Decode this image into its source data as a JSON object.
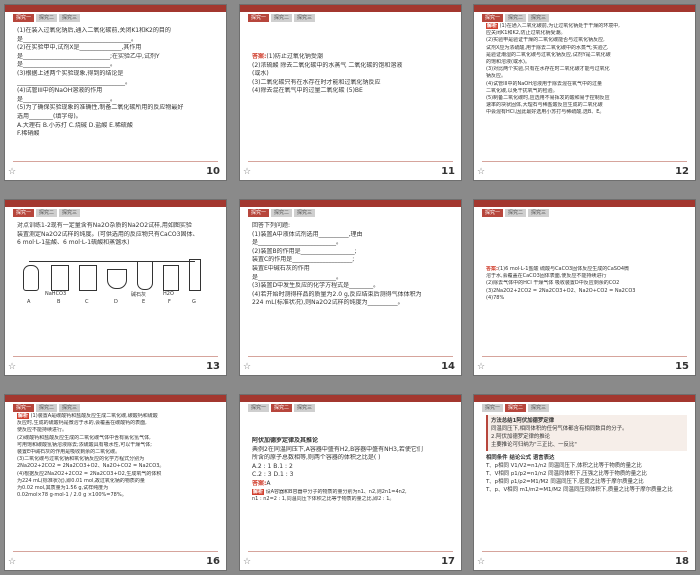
{
  "colors": {
    "accent": "#a3372f",
    "answer": "#d1402f",
    "background": "#8a8a8a"
  },
  "tabs": {
    "first": "探究一",
    "second": "探究二",
    "third": "探究三"
  },
  "slides": [
    {
      "number": "10",
      "lines": [
        "(1)在装入过氧化钠后,通入二氧化碳前,关闭K1和K2的目的",
        "是____________________________________。",
        "(2)在实验甲中,试剂X是______________,其作用",
        "是_____________________________;在实验乙中,试剂Y",
        "是_____________________________。",
        "(3)根据上述两个实验现象,得到的结论是",
        "____________________________________。",
        "(4)试管III中的NaOH溶液的作用",
        "是_____________________________。",
        "(5)为了确保实验现象的准确性,制备二氧化碳所用的反应物最好",
        "选用________(填字母)。",
        "A.大理石   B.小苏打   C.烧碱   D.盐酸   E.稀硫酸",
        "F.稀硝酸"
      ]
    },
    {
      "number": "11",
      "answer_label": "答案:",
      "lines": [
        "(1)防止过氧化钠受潮",
        "(2)浓硫酸  除去二氧化碳中的水蒸气  二氧化碳的饱和溶液",
        "(或水)",
        "(3)二氧化碳只有在水存在时才能和过氧化钠反应",
        "(4)除去混在氧气中的过量二氧化碳  (5)BE"
      ]
    },
    {
      "number": "12",
      "hint_label": "解析",
      "lines": [
        "(1)在通入二氧化碳前,为让过氧化钠处于干燥的环境中,",
        "应关闭K1和K2,防止过氧化钠受潮。",
        "(2)实验甲是验证干燥的二氧化碳能否与过氧化钠反应,",
        "试剂X应为浓硫酸,用于除去二氧化碳中的水蒸气;实验乙",
        "是验证潮湿的二氧化碳与过氧化钠反应,试剂Y是二氧化碳",
        "的饱和溶液(或水)。",
        "(3)对比两个实验,只有在水存在时二氧化碳才能与过氧化",
        "钠反应。",
        "(4)试管III中的NaOH溶液用于除去混在氧气中的过量",
        "二氧化碳,以免干扰氧气的检验。",
        "(5)制备二氧化碳时,应选用不易挥发的酸和易于控制反应",
        "速率的块状固体,大理石与稀盐酸反应生成的二氧化碳",
        "中会混有HCl,因此最好选用小苏打与稀硫酸,选B、E。"
      ]
    },
    {
      "number": "13",
      "lines": [
        "对点训练1-2现有一定量含有Na2O杂质的Na2O2试样,用如图实验",
        "装置测定Na2O2试样的纯度。(可供选用的反应物只有CaCO3固体、",
        "6 mol·L-1盐酸、6 mol·L-1硫酸和蒸馏水)"
      ],
      "apparatus_labels": [
        "A",
        "B",
        "C",
        "D",
        "E",
        "F",
        "G"
      ],
      "apparatus_captions": [
        "NaHCO3",
        "碱石灰",
        "H2O"
      ]
    },
    {
      "number": "14",
      "lines": [
        "回答下列问题:",
        "(1)装置A中液体试剂选用__________,理由",
        "是__________________________。",
        "(2)装置B的作用是__________________;",
        "装置C的作用是____________________;",
        "装置E中碱石灰的作用",
        "是__________________________。",
        "(3)装置D中发生反应的化学方程式是________。",
        "(4)若开始时测得样品的质量为2.0 g,反应结束后测得气体体积为",
        "224 mL(标准状况),则Na2O2试样的纯度为__________。"
      ]
    },
    {
      "number": "15",
      "answer_label": "答案:",
      "lines": [
        "(1)6 mol·L-1盐酸  硫酸与CaCO3固体反应生成的CaSO4微",
        "溶于水,会覆盖在CaCO3固体表面,使反应不能持续进行",
        "(2)除去气体中的HCl  干燥气体  吸收装置D中反应剩余的CO2",
        "(3)2Na2O2+2CO2 = 2Na2CO3+O2、Na2O+CO2 = Na2CO3",
        "(4)78%"
      ]
    },
    {
      "number": "16",
      "hint_label": "解析",
      "lines": [
        "(1)装置A是碳酸钙和盐酸反应生成二氧化碳,碳酸钙和硫酸",
        "反应时,生成的硫酸钙是微溶于水的,会覆盖在碳酸钙的表面,",
        "使反应不能持续进行。",
        "(2)碳酸钙和盐酸反应生成的二氧化碳气体中含有氯化氢气体,",
        "可用饱和碳酸氢钠溶液除去;浓硫酸具有吸水性,可以干燥气体;",
        "装置E中碱石灰的作用是吸收剩余的二氧化碳。",
        "(3)二氧化碳与过氧化钠和氧化钠反应的化学方程式分别为",
        "2Na2O2+2CO2 = 2Na2CO3+O2、Na2O+CO2 = Na2CO3。",
        "(4)根据反应2Na2O2+2CO2 = 2Na2CO3+O2,生成氧气的体积",
        "为224 mL(标准状况),即0.01 mol,故过氧化钠的物质的量",
        "为0.02 mol,其质量为1.56 g,试样纯度为",
        "0.02mol×78 g·mol-1 / 2.0 g ×100%=78%。"
      ]
    },
    {
      "number": "17",
      "answer_label": "答案:",
      "answer_value": "A",
      "hint_label": "解析",
      "lines": [
        "阿伏加德罗定律及其推论",
        "典例2在同温同压下,A容器中盛有H2,B容器中盛有NH3,若使它们",
        "所含的原子总数相等,则两个容器的体积之比是(    )",
        "A.2 : 1          B.1 : 2",
        "C.2 : 3          D.1 : 3",
        "设A容器和B容器中分子的物质的量分别为n1、n2,则2n1=4n2,",
        "n1 : n2=2 : 1,同温同压下体积之比等于物质的量之比,即2 : 1。"
      ]
    },
    {
      "number": "18",
      "lines": [
        "方法总结1阿伏加德罗定律",
        "同温同压下,相同体积的任何气体都含有相同数目的分子。",
        "2.阿伏加德罗定律的推论",
        "主要推论可归纳为\"三正比、一反比\"",
        "相同条件   结论公式   语言表达",
        "T、p相同   V1/V2=n1/n2   同温同压下,体积之比等于物质的量之比",
        "T、V相同   p1/p2=n1/n2   同温同体积下,压强之比等于物质的量之比",
        "T、p相同   ρ1/ρ2=M1/M2   同温同压下,密度之比等于摩尔质量之比",
        "T、p、V相同   m1/m2=M1/M2   同温同压同体积下,质量之比等于摩尔质量之比"
      ]
    }
  ]
}
